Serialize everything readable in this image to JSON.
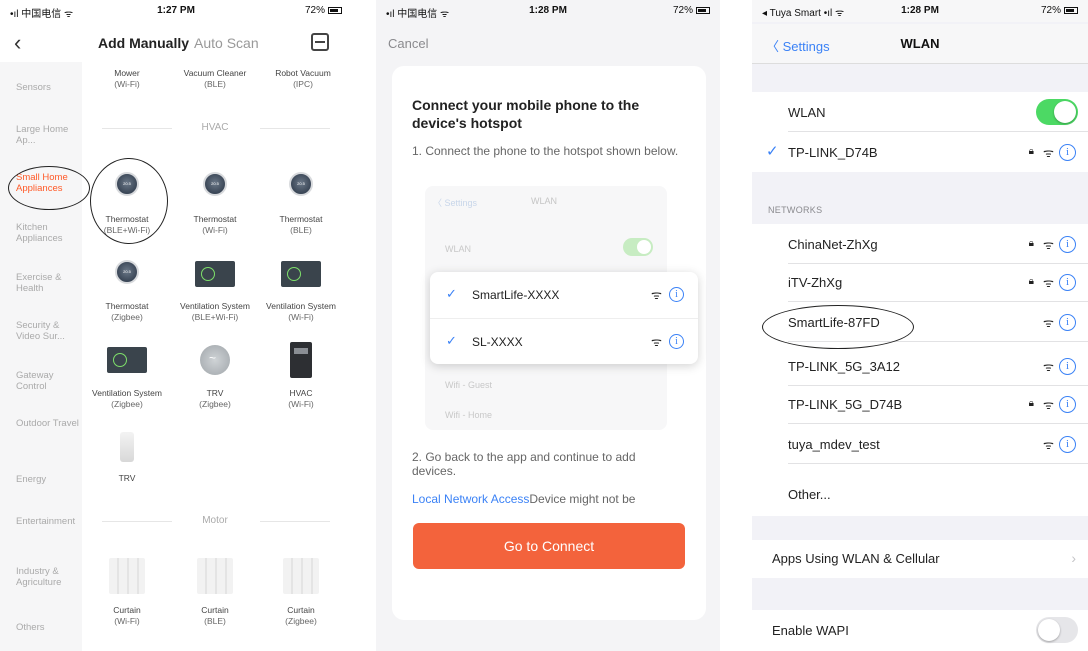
{
  "panel1": {
    "status": {
      "carrier": "•ıl 中国电信 ᯤ",
      "time": "1:27 PM",
      "battery": "72%"
    },
    "tabs": {
      "manual": "Add Manually",
      "scan": "Auto Scan"
    },
    "sidebar": [
      "Sensors",
      "Large Home Ap...",
      "Small Home Appliances",
      "Kitchen Appliances",
      "Exercise & Health",
      "Security & Video Sur...",
      "Gateway Control",
      "Outdoor Travel",
      "Energy",
      "Entertainment",
      "Industry & Agriculture",
      "Others"
    ],
    "top_devices": [
      {
        "name": "Mower",
        "sub": "(Wi-Fi)"
      },
      {
        "name": "Vacuum Cleaner",
        "sub": "(BLE)"
      },
      {
        "name": "Robot Vacuum",
        "sub": "(IPC)"
      }
    ],
    "section_hvac": "HVAC",
    "hvac_devices": [
      {
        "name": "Thermostat",
        "sub": "(BLE+Wi-Fi)"
      },
      {
        "name": "Thermostat",
        "sub": "(Wi-Fi)"
      },
      {
        "name": "Thermostat",
        "sub": "(BLE)"
      },
      {
        "name": "Thermostat",
        "sub": "(Zigbee)"
      },
      {
        "name": "Ventilation System",
        "sub": "(BLE+Wi-Fi)"
      },
      {
        "name": "Ventilation System",
        "sub": "(Wi-Fi)"
      },
      {
        "name": "Ventilation System",
        "sub": "(Zigbee)"
      },
      {
        "name": "TRV",
        "sub": "(Zigbee)"
      },
      {
        "name": "HVAC",
        "sub": "(Wi-Fi)"
      },
      {
        "name": "TRV",
        "sub": ""
      }
    ],
    "section_motor": "Motor",
    "motor_devices": [
      {
        "name": "Curtain",
        "sub": "(Wi-Fi)"
      },
      {
        "name": "Curtain",
        "sub": "(BLE)"
      },
      {
        "name": "Curtain",
        "sub": "(Zigbee)"
      }
    ]
  },
  "panel2": {
    "status": {
      "carrier": "•ıl 中国电信 ᯤ",
      "time": "1:28 PM",
      "battery": "72%"
    },
    "cancel": "Cancel",
    "title": "Connect your mobile phone to the device's hotspot",
    "step1": "1. Connect the phone to the hotspot shown below.",
    "mini": {
      "settings": "〈 Settings",
      "title": "WLAN",
      "wlan": "WLAN",
      "guest": "Wifi - Guest",
      "home": "Wifi - Home"
    },
    "popup_networks": [
      "SmartLife-XXXX",
      "SL-XXXX"
    ],
    "step2": "2. Go back to the app and continue to add devices.",
    "link": "Local Network Access",
    "link_tail": "Device might not be",
    "button": "Go to Connect"
  },
  "panel3": {
    "status": {
      "carrier": "◂ Tuya Smart •ıl ᯤ",
      "time": "1:28 PM",
      "battery": "72%"
    },
    "back": "Settings",
    "title": "WLAN",
    "wlan_label": "WLAN",
    "wlan_on": true,
    "connected": "TP-LINK_D74B",
    "networks_header": "NETWORKS",
    "networks": [
      {
        "name": "ChinaNet-ZhXg",
        "locked": true
      },
      {
        "name": "iTV-ZhXg",
        "locked": true
      },
      {
        "name": "SmartLife-87FD",
        "locked": false
      },
      {
        "name": "TP-LINK_5G_3A12",
        "locked": false
      },
      {
        "name": "TP-LINK_5G_D74B",
        "locked": true
      },
      {
        "name": "tuya_mdev_test",
        "locked": false
      }
    ],
    "other": "Other...",
    "apps_row": "Apps Using WLAN & Cellular",
    "wapi_row": "Enable WAPI",
    "wapi_on": false
  },
  "colors": {
    "accent_orange": "#f3633c",
    "ios_blue": "#3b82f6",
    "toggle_green": "#4cd964"
  }
}
